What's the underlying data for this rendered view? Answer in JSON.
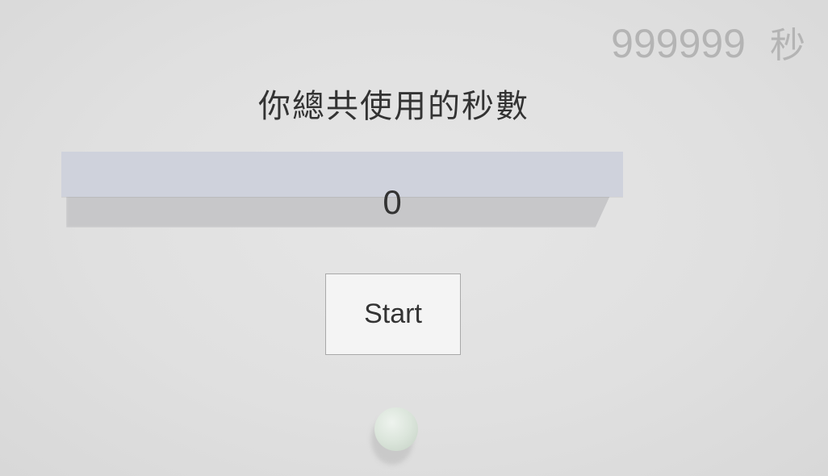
{
  "hud": {
    "timer_value": "999999",
    "timer_unit": "秒"
  },
  "panel": {
    "title": "你總共使用的秒數",
    "score": "0"
  },
  "controls": {
    "start_label": "Start"
  },
  "scene": {
    "ball_color": "#dbe5db",
    "background_color": "#e0e0e0",
    "panel_color": "#cfd2dc"
  }
}
